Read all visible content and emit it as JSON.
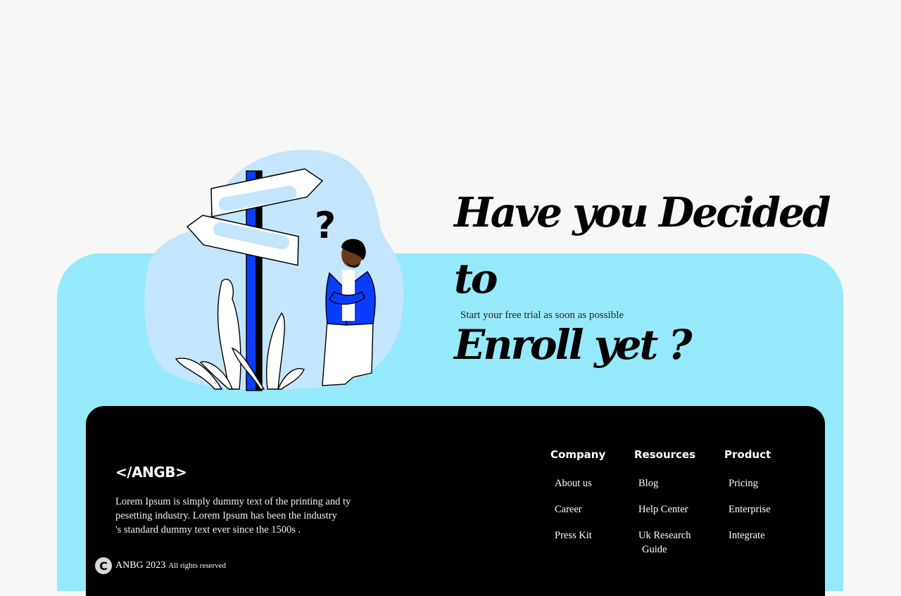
{
  "hero": {
    "headline_line1": "Have you Decided to",
    "headline_line2": "Enroll yet ?",
    "subtext": "Start your free trial as soon as possible"
  },
  "footer": {
    "logo": "</ANGB>",
    "description": "Lorem Ipsum is simply dummy text of the printing and ty\npesetting industry. Lorem Ipsum has been the industry\n's standard dummy text ever since the 1500s .",
    "copyright_icon": "C",
    "copyright_brand": "ANBG 2023",
    "copyright_rights": "All rights reserved",
    "columns": [
      {
        "title": "Company",
        "links": [
          "About us",
          "Career",
          "Press Kit"
        ]
      },
      {
        "title": "Resources",
        "links": [
          "Blog",
          "Help Center",
          "Uk Research",
          "Guide"
        ]
      },
      {
        "title": "Product",
        "links": [
          "Pricing",
          "Enterprise",
          "Integrate"
        ]
      }
    ]
  },
  "colors": {
    "background": "#f7f7f7",
    "panel": "#96e9fb",
    "blob": "#c3e6fc",
    "accent_blue": "#0a3cff",
    "footer": "#000000"
  },
  "icons": {
    "illustration": "signpost-person-illustration",
    "question_mark": "question-mark-icon",
    "copyright": "copyright-icon"
  }
}
